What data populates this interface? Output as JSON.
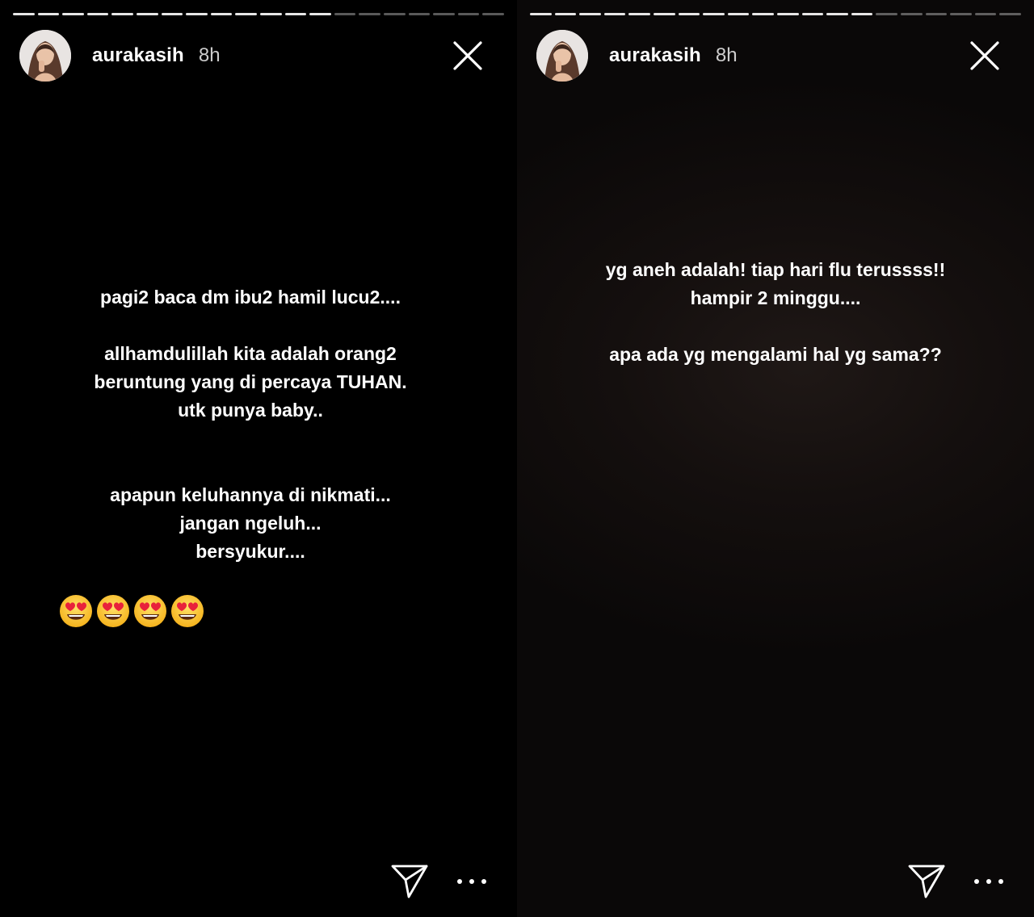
{
  "stories": [
    {
      "progress": {
        "segments_total": 20,
        "segments_viewed": 13
      },
      "username": "aurakasih",
      "time": "8h",
      "lines": [
        "pagi2 baca dm ibu2 hamil lucu2....",
        "allhamdulillah kita adalah orang2",
        "beruntung yang di percaya TUHAN.",
        "utk punya baby..",
        "apapun keluhannya di nikmati...",
        "jangan ngeluh...",
        "bersyukur...."
      ],
      "emoji_count": 4,
      "emoji_name": "heart-eyes-emoji"
    },
    {
      "progress": {
        "segments_total": 20,
        "segments_viewed": 14
      },
      "username": "aurakasih",
      "time": "8h",
      "lines": [
        "yg aneh adalah! tiap hari flu terussss!!",
        "hampir 2 minggu....",
        "apa ada yg mengalami hal yg sama??"
      ]
    }
  ],
  "icons": {
    "close": "close-icon",
    "send": "send-icon",
    "more": "more-options-icon"
  },
  "colors": {
    "background": "#000000",
    "text": "#ffffff",
    "progress_done": "#e6e6e6",
    "progress_pending": "#595959"
  }
}
